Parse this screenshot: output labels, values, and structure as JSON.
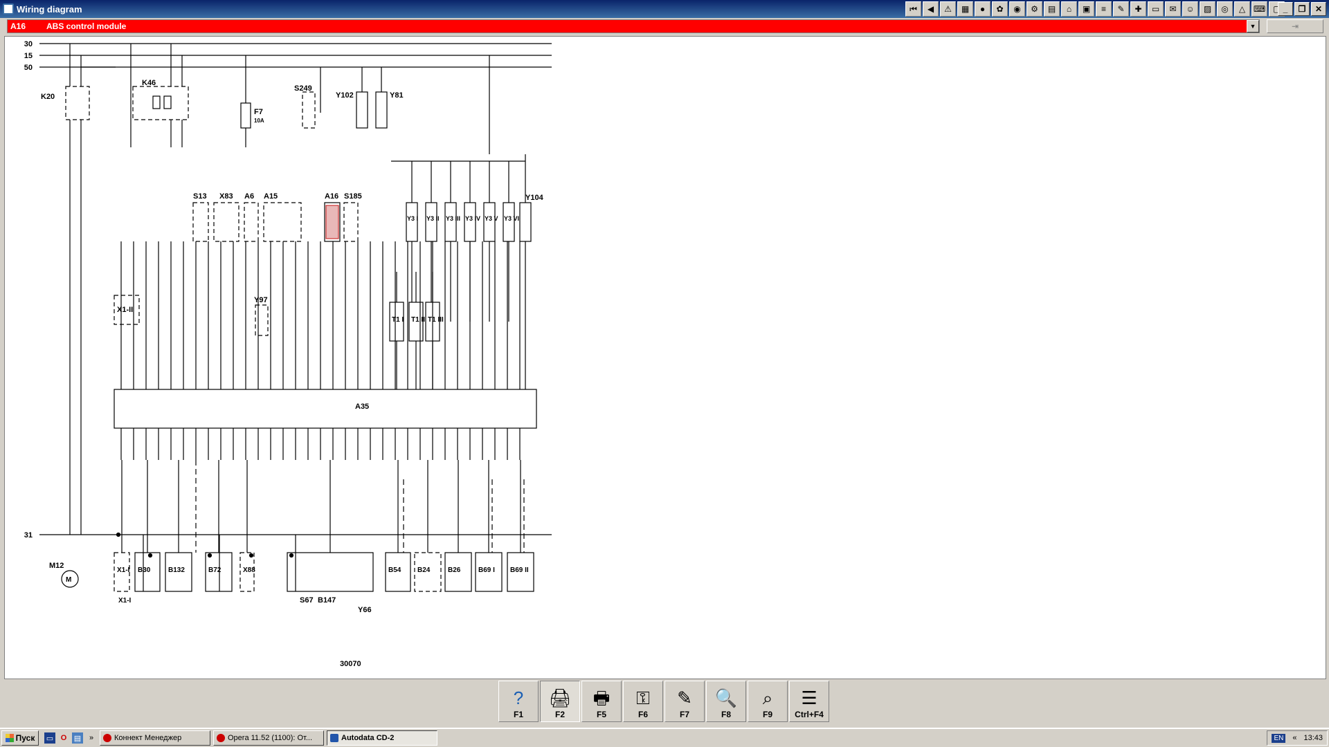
{
  "window": {
    "title": "Wiring diagram"
  },
  "toolbar": {
    "buttons": [
      "⏮",
      "◀",
      "⚠",
      "▦",
      "●",
      "✿",
      "◉",
      "⚙",
      "▤",
      "⌂",
      "▣",
      "≡",
      "✎",
      "✚",
      "▭",
      "✉",
      "☺",
      "▨",
      "◎",
      "△",
      "⌨",
      "▢"
    ]
  },
  "window_controls": {
    "minimize": "_",
    "restore": "❐",
    "close": "✕"
  },
  "selector": {
    "code": "A16",
    "name": "ABS control module",
    "side_button": "⇥"
  },
  "diagram": {
    "rails": [
      "30",
      "15",
      "50",
      "31"
    ],
    "bottom_ref": "30070",
    "components": [
      "K20",
      "K46",
      "F7",
      "S249",
      "Y102",
      "Y81",
      "S13",
      "X83",
      "A6",
      "A15",
      "A16",
      "S185",
      "Y3 I",
      "Y3 II",
      "Y3 III",
      "Y3 IV",
      "Y3 V",
      "Y3 VI",
      "Y104",
      "X1-II",
      "Y97",
      "T1 I",
      "T1 II",
      "T1 III",
      "A35",
      "M12",
      "X1-I",
      "B30",
      "B132",
      "B72",
      "X88",
      "S67",
      "B147",
      "Y66",
      "B54",
      "B24",
      "B26",
      "B69 I",
      "B69 II"
    ],
    "f7_rating": "10A",
    "fuse_label": "F7",
    "motor_letter": "M"
  },
  "fkeys": [
    {
      "label": "F1",
      "icon": "?"
    },
    {
      "label": "F2",
      "icon": "🖨"
    },
    {
      "label": "F5",
      "icon": "🖶"
    },
    {
      "label": "F6",
      "icon": "⚿"
    },
    {
      "label": "F7",
      "icon": "✎"
    },
    {
      "label": "F8",
      "icon": "🔍"
    },
    {
      "label": "F9",
      "icon": "⌕"
    },
    {
      "label": "Ctrl+F4",
      "icon": "☰"
    }
  ],
  "taskbar": {
    "start_label": "Пуск",
    "tasks": [
      {
        "label": "Коннект Менеджер"
      },
      {
        "label": "Opera 11.52 (1100): От..."
      },
      {
        "label": "Autodata CD-2"
      }
    ],
    "lang": "EN",
    "chevron": "«",
    "time": "13:43"
  }
}
